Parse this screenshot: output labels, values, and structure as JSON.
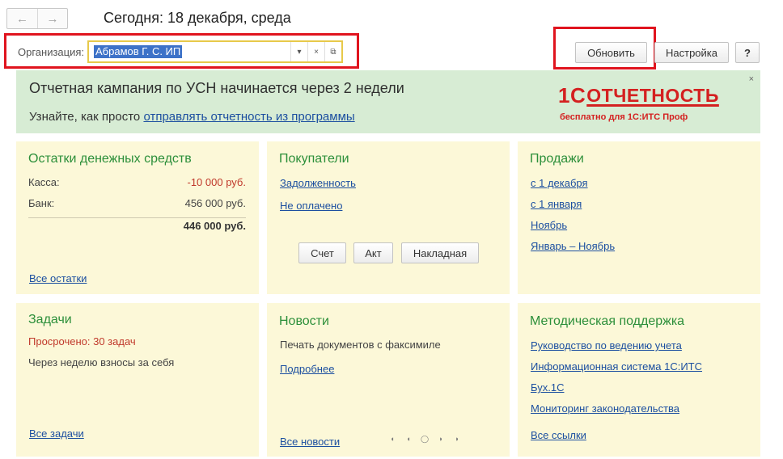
{
  "header": {
    "back_icon": "arrow-left-icon",
    "forward_icon": "arrow-right-icon",
    "back_glyph": "←",
    "forward_glyph": "→",
    "title": "Сегодня: 18 декабря, среда"
  },
  "organization": {
    "label": "Организация:",
    "value": "Абрамов Г. С. ИП",
    "dropdown_glyph": "▾",
    "clear_glyph": "×",
    "open_glyph": "⧉"
  },
  "toolbar": {
    "refresh_label": "Обновить",
    "settings_label": "Настройка",
    "help_label": "?"
  },
  "banner": {
    "title": "Отчетная кампания по УСН начинается через 2 недели",
    "text_prefix": "Узнайте, как просто ",
    "link": "отправлять отчетность из программы",
    "close_glyph": "×",
    "brand_1c": "1С",
    "brand_word": "ОТЧЕТНОСТЬ",
    "brand_subtitle": "бесплатно для 1С:ИТС Проф"
  },
  "cash": {
    "title": "Остатки денежных средств",
    "rows": [
      {
        "label": "Касса:",
        "amount": "-10 000 руб."
      },
      {
        "label": "Банк:",
        "amount": "456 000 руб."
      }
    ],
    "total": "446 000 руб.",
    "link": "Все остатки"
  },
  "buyers": {
    "title": "Покупатели",
    "links": [
      "Задолженность",
      "Не оплачено"
    ],
    "buttons": [
      "Счет",
      "Акт",
      "Накладная"
    ]
  },
  "sales": {
    "title": "Продажи",
    "links": [
      "с 1 декабря",
      "с 1 января",
      "Ноябрь",
      "Январь – Ноябрь"
    ]
  },
  "tasks": {
    "title": "Задачи",
    "overdue": "Просрочено: 30 задач",
    "item": "Через неделю взносы за себя",
    "link": "Все задачи"
  },
  "news": {
    "title": "Новости",
    "item": "Печать документов с факсимиле",
    "more_link": "Подробнее",
    "all_link": "Все новости",
    "pager": [
      "◖",
      "◖",
      "◯",
      "◗",
      "◗"
    ]
  },
  "support": {
    "title": "Методическая поддержка",
    "links": [
      "Руководство по ведению учета",
      "Информационная система 1С:ИТС",
      "Бух.1С",
      "Мониторинг законодательства"
    ],
    "all_link": "Все ссылки"
  },
  "colors": {
    "highlight": "#e0141e",
    "banner_bg": "#d7ecd4",
    "panel_bg": "#fcf8d8",
    "title_green": "#2c8f3a",
    "link_blue": "#1c4fa0",
    "brand_red": "#d42020"
  }
}
